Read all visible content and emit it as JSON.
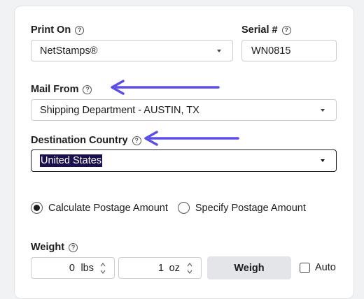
{
  "print_on": {
    "label": "Print On",
    "help_icon": "question-circle-icon",
    "value": "NetStamps®"
  },
  "serial": {
    "label": "Serial #",
    "help_icon": "question-circle-icon",
    "value": "WN0815"
  },
  "mail_from": {
    "label": "Mail From",
    "help_icon": "question-circle-icon",
    "value": "Shipping Department - AUSTIN, TX"
  },
  "destination_country": {
    "label": "Destination Country",
    "help_icon": "question-circle-icon",
    "value": "United States"
  },
  "postage_mode": {
    "options": [
      "Calculate Postage Amount",
      "Specify Postage Amount"
    ],
    "selected": "Calculate Postage Amount"
  },
  "weight": {
    "label": "Weight",
    "help_icon": "question-circle-icon",
    "lbs_value": "0",
    "lbs_unit": "lbs",
    "oz_value": "1",
    "oz_unit": "oz",
    "weigh_button": "Weigh",
    "auto_label": "Auto",
    "auto_checked": false
  },
  "annotation_arrow_color": "#5b4ee8"
}
